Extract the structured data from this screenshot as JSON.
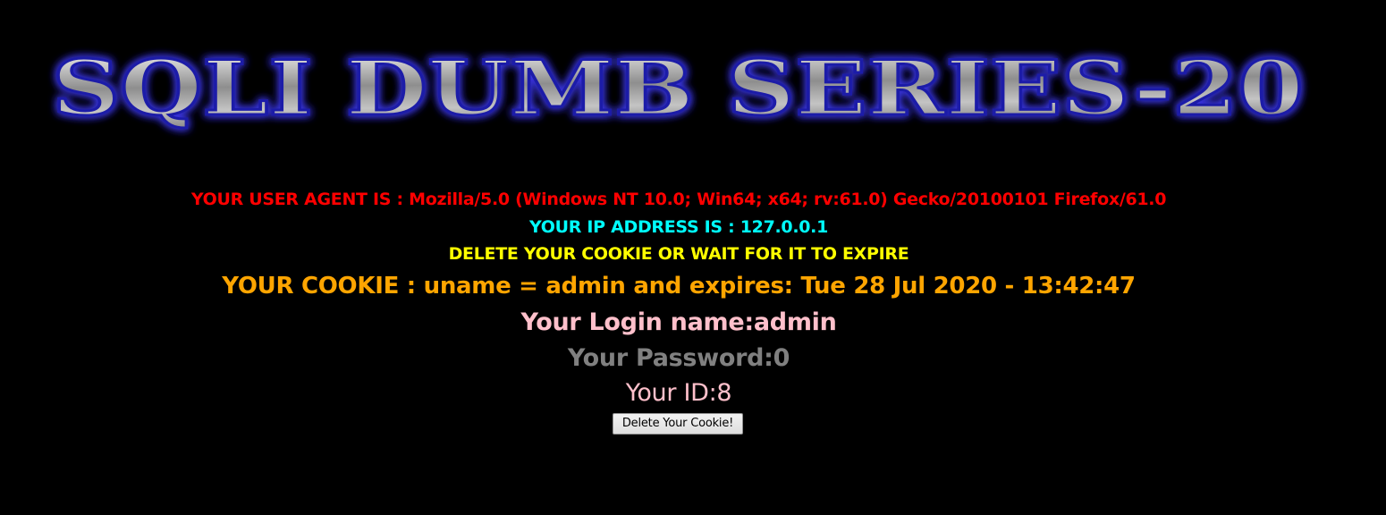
{
  "banner": {
    "title": "SQLI DUMB SERIES-20"
  },
  "info": {
    "user_agent_label": "YOUR USER AGENT IS : ",
    "user_agent_value": "Mozilla/5.0 (Windows NT 10.0; Win64; x64; rv:61.0) Gecko/20100101 Firefox/61.0",
    "ip_label": "YOUR IP ADDRESS IS : ",
    "ip_value": "127.0.0.1",
    "delete_notice": "DELETE YOUR COOKIE OR WAIT FOR IT TO EXPIRE",
    "cookie_text": "YOUR COOKIE : uname = admin and expires: Tue 28 Jul 2020 - 13:42:47",
    "login_text": "Your Login name:admin",
    "password_text": "Your Password:0",
    "id_text": "Your ID:8"
  },
  "form": {
    "delete_button_label": "Delete Your Cookie!"
  },
  "colors": {
    "user_agent": "#ff0000",
    "ip": "#00ffff",
    "delete_notice": "#ffff00",
    "cookie": "#ffa500",
    "login": "#ffc0cb",
    "password": "#808080",
    "id": "#ffc0cb",
    "banner_glow": "#3a35e0",
    "background": "#000000"
  }
}
